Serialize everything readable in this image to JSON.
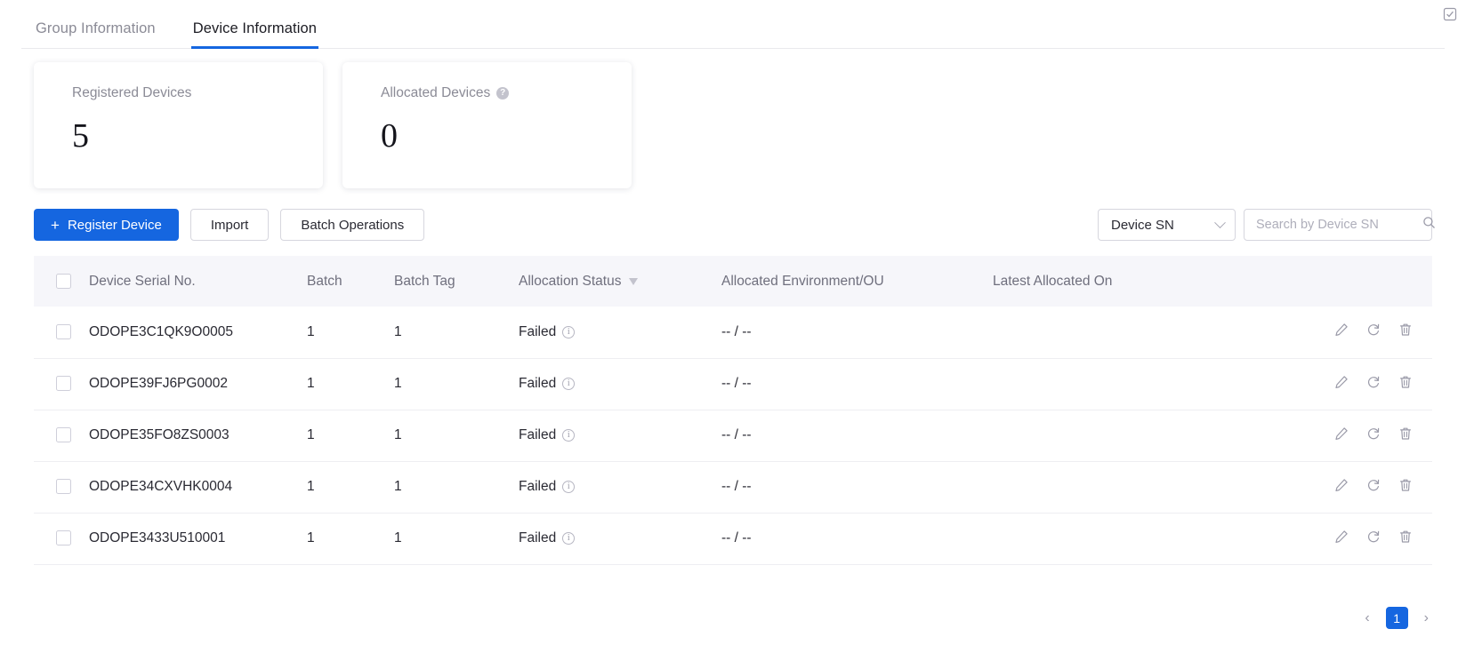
{
  "tabs": [
    {
      "label": "Group Information",
      "active": false
    },
    {
      "label": "Device Information",
      "active": true
    }
  ],
  "stats": [
    {
      "label": "Registered Devices",
      "value": "5",
      "has_help": false
    },
    {
      "label": "Allocated Devices",
      "value": "0",
      "has_help": true,
      "help_glyph": "?"
    }
  ],
  "toolbar": {
    "register_label": "Register Device",
    "register_plus": "+",
    "import_label": "Import",
    "batch_label": "Batch Operations",
    "filter_select_value": "Device SN",
    "search_placeholder": "Search by Device SN",
    "search_value": ""
  },
  "table": {
    "columns": [
      "Device Serial No.",
      "Batch",
      "Batch Tag",
      "Allocation Status",
      "Allocated Environment/OU",
      "Latest Allocated On"
    ],
    "rows": [
      {
        "sn": "ODOPE3C1QK9O0005",
        "batch": "1",
        "batch_tag": "1",
        "status": "Failed",
        "env": "-- / --",
        "latest": ""
      },
      {
        "sn": "ODOPE39FJ6PG0002",
        "batch": "1",
        "batch_tag": "1",
        "status": "Failed",
        "env": "-- / --",
        "latest": ""
      },
      {
        "sn": "ODOPE35FO8ZS0003",
        "batch": "1",
        "batch_tag": "1",
        "status": "Failed",
        "env": "-- / --",
        "latest": ""
      },
      {
        "sn": "ODOPE34CXVHK0004",
        "batch": "1",
        "batch_tag": "1",
        "status": "Failed",
        "env": "-- / --",
        "latest": ""
      },
      {
        "sn": "ODOPE3433U510001",
        "batch": "1",
        "batch_tag": "1",
        "status": "Failed",
        "env": "-- / --",
        "latest": ""
      }
    ],
    "info_glyph": "i"
  },
  "pagination": {
    "prev": "‹",
    "next": "›",
    "current_page": "1"
  },
  "colors": {
    "accent": "#1566e0",
    "header_bg": "#f6f6fa",
    "text": "#2a2a33",
    "muted": "#8b8b96"
  }
}
